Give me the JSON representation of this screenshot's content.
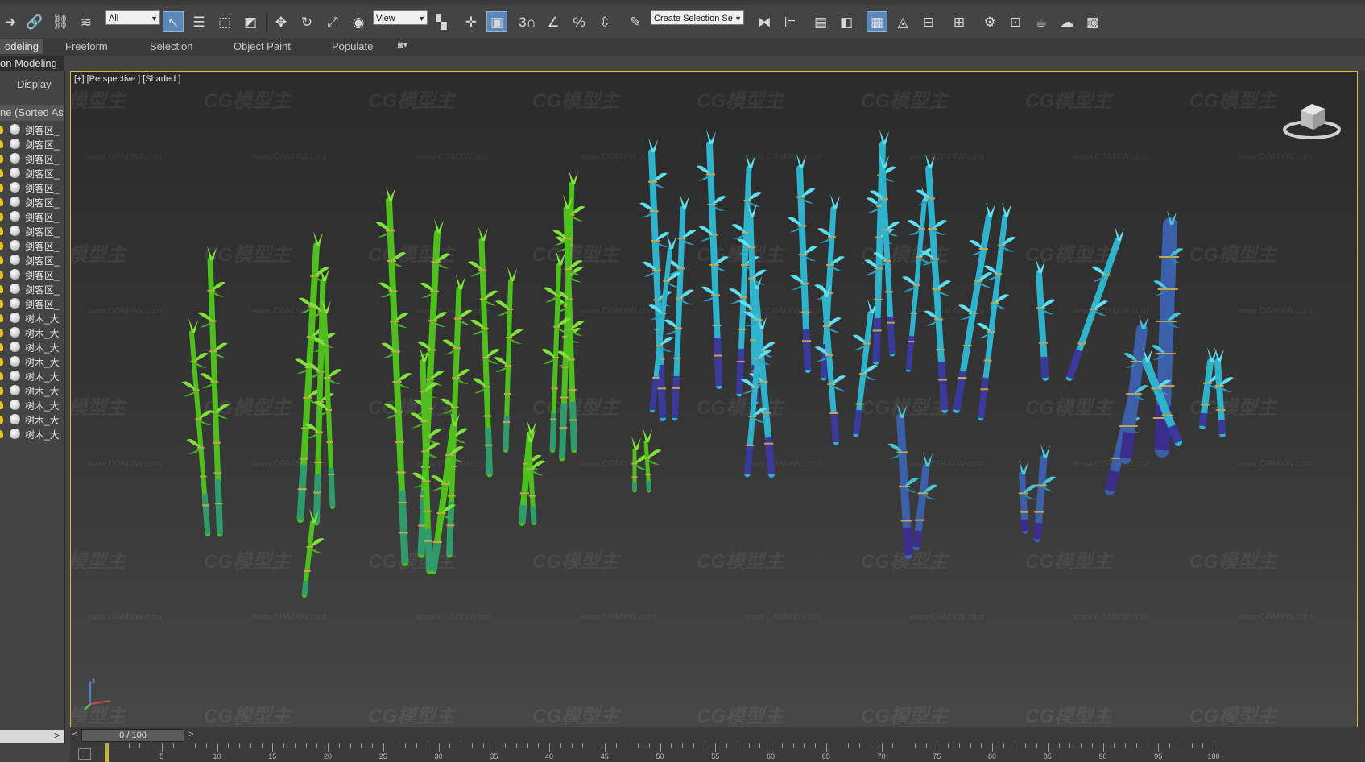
{
  "toolbar": {
    "selection_filter": "All",
    "reference_coord": "View",
    "named_selection_placeholder": "Create Selection Se",
    "snap_label": "3",
    "percent_label": "%"
  },
  "ribbon": {
    "tabs": [
      "odeling",
      "Freeform",
      "Selection",
      "Object Paint",
      "Populate"
    ],
    "active_tab_index": 0,
    "sub_label": "on Modeling"
  },
  "explorer": {
    "display_label": "Display",
    "column_header": "ne (Sorted Asc",
    "items": [
      "剑客区_",
      "剑客区_",
      "剑客区_",
      "剑客区_",
      "剑客区_",
      "剑客区_",
      "剑客区_",
      "剑客区_",
      "剑客区_",
      "剑客区_",
      "剑客区_",
      "剑客区_",
      "剑客区_",
      "树木_大",
      "树木_大",
      "树木_大",
      "树木_大",
      "树木_大",
      "树木_大",
      "树木_大",
      "树木_大",
      "树木_大"
    ]
  },
  "viewport": {
    "label": "[+] [Perspective ] [Shaded ]",
    "watermark_logo": "CG模型主",
    "watermark_url": "www.CGMXW.com"
  },
  "timeline": {
    "slider_text": "0 / 100",
    "prev_arrow": "<",
    "next_arrow": ">",
    "current_frame": 0,
    "total_frames": 100,
    "ruler_labels": [
      "5",
      "10",
      "15",
      "20",
      "25",
      "30",
      "35",
      "40",
      "45",
      "50",
      "55",
      "60",
      "65",
      "70",
      "75",
      "80",
      "85",
      "90",
      "95",
      "100"
    ]
  },
  "colors": {
    "active_button": "#5d87b8",
    "viewport_border": "#d6b948",
    "bamboo_green": "#5fd22a",
    "bamboo_cyan": "#38c8e0",
    "bamboo_purple": "#4a3a9a",
    "band_gold": "#c9a24a"
  }
}
